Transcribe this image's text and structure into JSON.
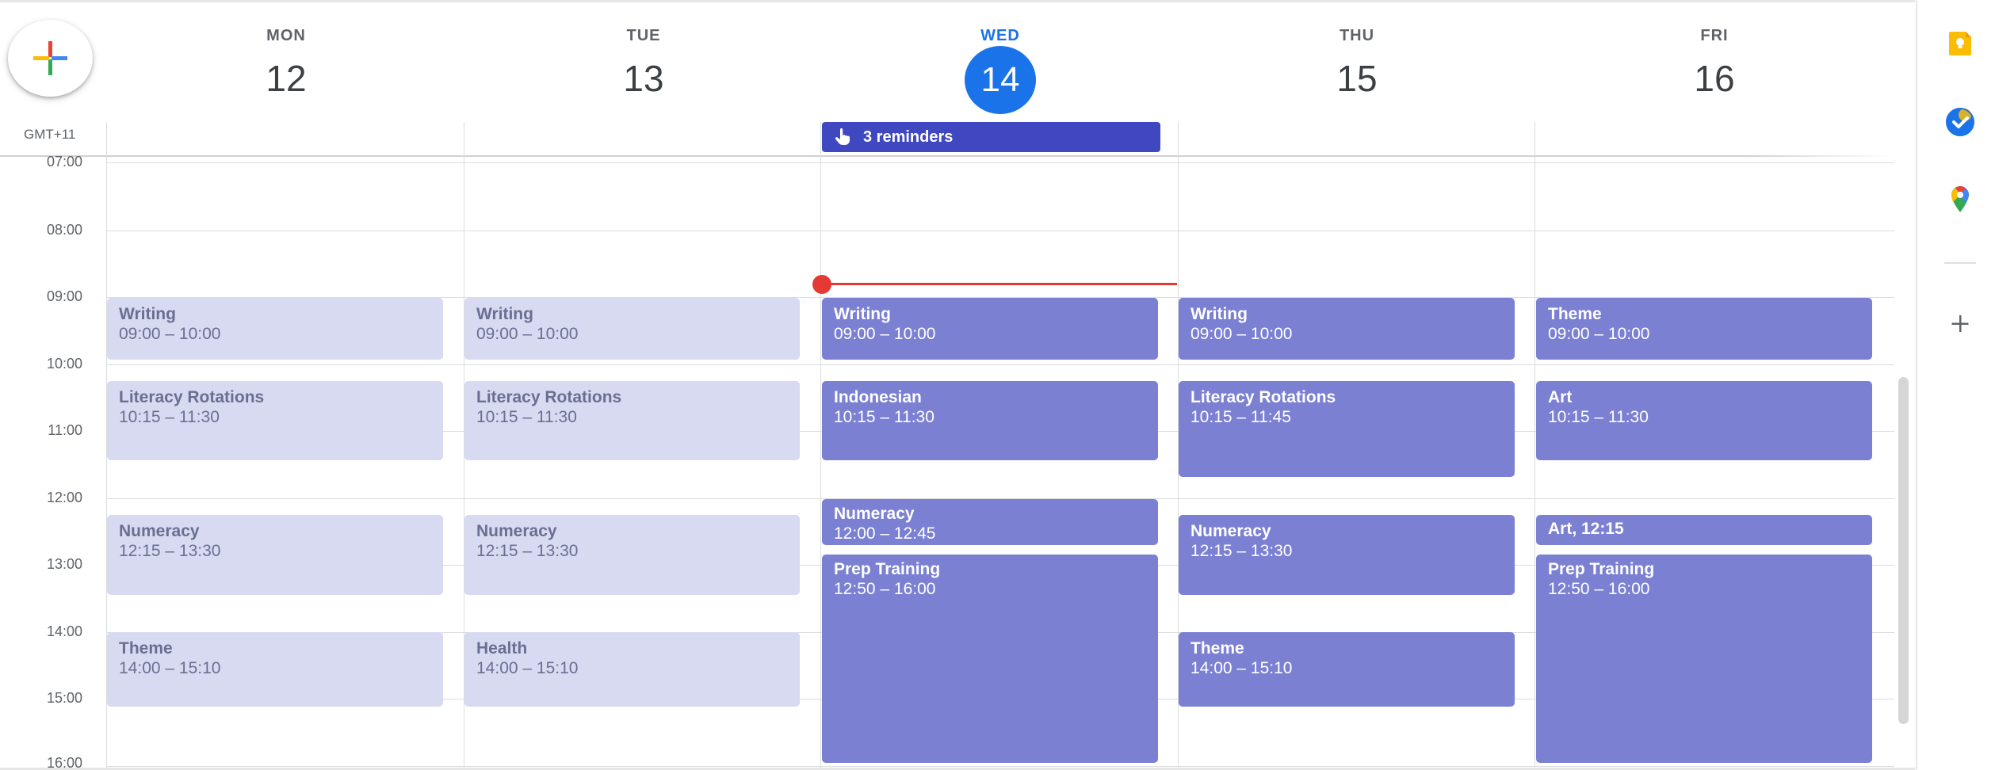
{
  "timezone": "GMT+11",
  "days": [
    {
      "name": "MON",
      "num": "12"
    },
    {
      "name": "TUE",
      "num": "13"
    },
    {
      "name": "WED",
      "num": "14"
    },
    {
      "name": "THU",
      "num": "15"
    },
    {
      "name": "FRI",
      "num": "16"
    }
  ],
  "reminders": {
    "label": "3 reminders"
  },
  "times": [
    "07:00",
    "08:00",
    "09:00",
    "10:00",
    "11:00",
    "12:00",
    "13:00",
    "14:00",
    "15:00",
    "16:00"
  ],
  "events": {
    "mon": [
      {
        "title": "Writing",
        "time": "09:00 – 10:00"
      },
      {
        "title": "Literacy Rotations",
        "time": "10:15 – 11:30"
      },
      {
        "title": "Numeracy",
        "time": "12:15 – 13:30"
      },
      {
        "title": "Theme",
        "time": "14:00 – 15:10"
      }
    ],
    "tue": [
      {
        "title": "Writing",
        "time": "09:00 – 10:00"
      },
      {
        "title": "Literacy Rotations",
        "time": "10:15 – 11:30"
      },
      {
        "title": "Numeracy",
        "time": "12:15 – 13:30"
      },
      {
        "title": "Health",
        "time": "14:00 – 15:10"
      }
    ],
    "wed": [
      {
        "title": "Writing",
        "time": "09:00 – 10:00"
      },
      {
        "title": "Indonesian",
        "time": "10:15 – 11:30"
      },
      {
        "title": "Numeracy",
        "time": "12:00 – 12:45"
      },
      {
        "title": "Prep Training",
        "time": "12:50 – 16:00"
      }
    ],
    "thu": [
      {
        "title": "Writing",
        "time": "09:00 – 10:00"
      },
      {
        "title": "Literacy Rotations",
        "time": "10:15 – 11:45"
      },
      {
        "title": "Numeracy",
        "time": "12:15 – 13:30"
      },
      {
        "title": "Theme",
        "time": "14:00 – 15:10"
      }
    ],
    "fri": [
      {
        "title": "Theme",
        "time": "09:00 – 10:00"
      },
      {
        "title": "Art",
        "time": "10:15 – 11:30"
      },
      {
        "title": "Art, 12:15"
      },
      {
        "title": "Prep Training",
        "time": "12:50 – 16:00"
      }
    ]
  },
  "colors": {
    "past_event": "#d8daf1",
    "event": "#7b80d3",
    "today": "#1a73e8",
    "now_line": "#e53935",
    "reminder": "#3f48c1"
  },
  "side_icons": [
    "keep-icon",
    "tasks-icon",
    "maps-icon",
    "add-icon"
  ]
}
